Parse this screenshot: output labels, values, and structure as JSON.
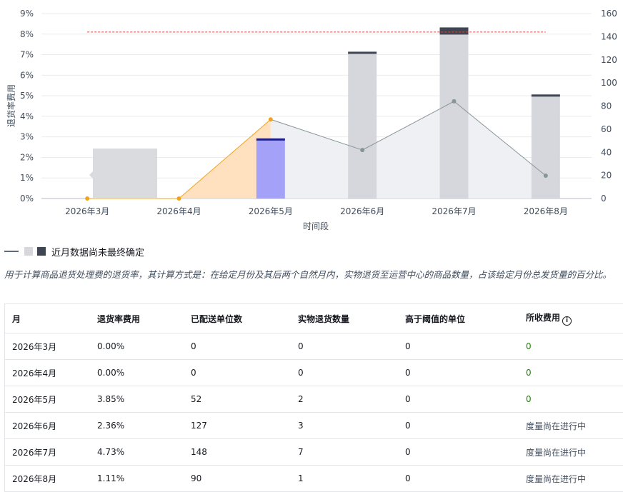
{
  "chart_data": {
    "type": "bar+line",
    "categories": [
      "2026年3月",
      "2026年4月",
      "2026年5月",
      "2026年6月",
      "2026年7月",
      "2026年8月"
    ],
    "xlabel": "时间段",
    "ylabel_left": "退货率费用",
    "ylabel_right": "",
    "y_left_ticks": [
      "0%",
      "1%",
      "2%",
      "3%",
      "4%",
      "5%",
      "6%",
      "7%",
      "8%",
      "9%"
    ],
    "y_right_ticks": [
      "0",
      "20",
      "40",
      "60",
      "80",
      "100",
      "120",
      "140",
      "160"
    ],
    "ylim_left": [
      0,
      9
    ],
    "ylim_right": [
      0,
      160
    ],
    "threshold_left": 8.1,
    "bars_right": [
      0,
      0,
      52,
      127,
      148,
      90
    ],
    "line_left": [
      0.0,
      0.0,
      3.85,
      2.36,
      4.73,
      1.11
    ],
    "grid": true,
    "colors": {
      "bar_pending": "#d5d7dc",
      "bar_pending_cap": "#3f4652",
      "bar_highlight": "#a3a2f8",
      "bar_highlight_cap": "#1f1d8a",
      "line": "#879596",
      "line_highlight": "#f0a31c",
      "area_highlight": "#ffe1bf",
      "area": "#eef0f3",
      "threshold": "#e0413c",
      "tooltip_bg": "#d8d9dc"
    }
  },
  "legend": {
    "label": "近月数据尚未最终确定"
  },
  "description": "用于计算商品退货处理费的退货率，其计算方式是：在给定月份及其后两个自然月内，实物退货至运营中心的商品数量，占该给定月份总发货量的百分比。",
  "table": {
    "headers": {
      "month": "月",
      "rate": "退货率费用",
      "shipped": "已配送单位数",
      "returns": "实物退货数量",
      "above": "高于阈值的单位",
      "fee": "所收费用",
      "fee_info_icon": "i"
    },
    "rows": [
      {
        "month": "2026年3月",
        "rate": "0.00%",
        "shipped": "0",
        "returns": "0",
        "above": "0",
        "fee": "0"
      },
      {
        "month": "2026年4月",
        "rate": "0.00%",
        "shipped": "0",
        "returns": "0",
        "above": "0",
        "fee": "0"
      },
      {
        "month": "2026年5月",
        "rate": "3.85%",
        "shipped": "52",
        "returns": "2",
        "above": "0",
        "fee": "0"
      },
      {
        "month": "2026年6月",
        "rate": "2.36%",
        "shipped": "127",
        "returns": "3",
        "above": "0",
        "fee": "度量尚在进行中"
      },
      {
        "month": "2026年7月",
        "rate": "4.73%",
        "shipped": "148",
        "returns": "7",
        "above": "0",
        "fee": "度量尚在进行中"
      },
      {
        "month": "2026年8月",
        "rate": "1.11%",
        "shipped": "90",
        "returns": "1",
        "above": "0",
        "fee": "度量尚在进行中"
      }
    ]
  }
}
